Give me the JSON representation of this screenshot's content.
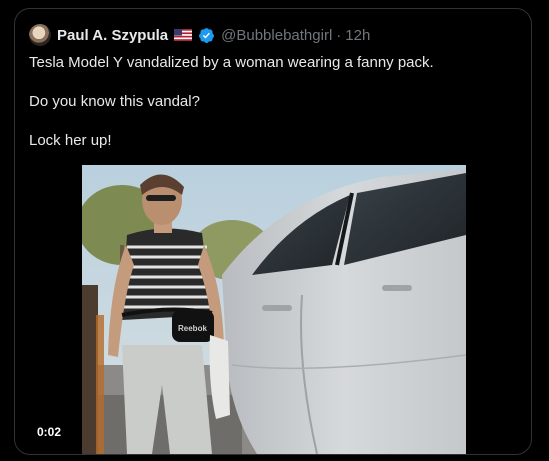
{
  "tweet": {
    "author_name": "Paul A. Szypula",
    "handle": "@Bubblebathgirl",
    "separator": "·",
    "time": "12h",
    "paragraphs": [
      "Tesla Model Y vandalized by a woman wearing a fanny pack.",
      "Do you know this vandal?",
      "Lock her up!"
    ],
    "flag_icon": "us-flag-icon",
    "verified_icon": "verified-badge-icon",
    "verified_color": "#1d9bf0"
  },
  "media": {
    "type": "video",
    "duration_label": "0:02",
    "bag_text": "Reebok"
  }
}
